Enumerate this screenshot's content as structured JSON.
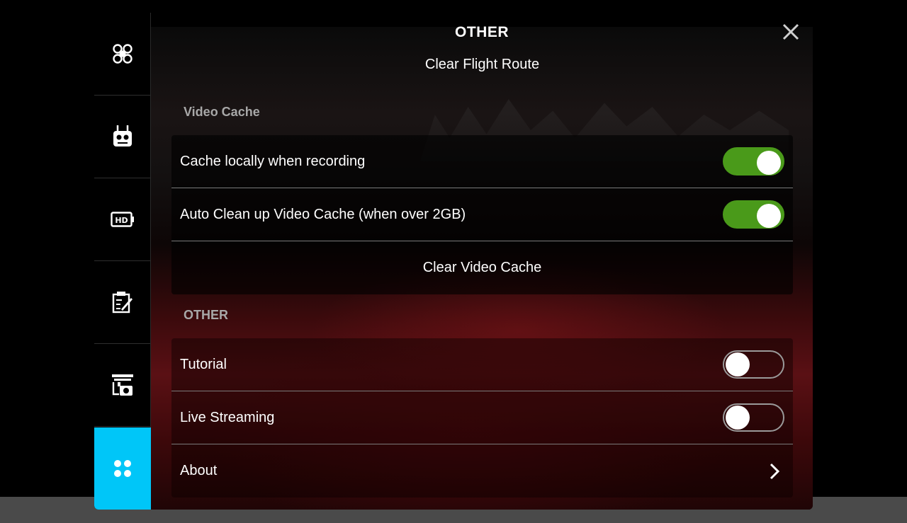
{
  "header": {
    "title": "OTHER"
  },
  "sidebar": {
    "items": [
      {
        "icon": "aircraft-icon"
      },
      {
        "icon": "remote-controller-icon"
      },
      {
        "icon": "hd-transmission-icon"
      },
      {
        "icon": "checklist-icon"
      },
      {
        "icon": "gimbal-camera-icon"
      },
      {
        "icon": "more-dots-icon",
        "active": true
      }
    ],
    "active_color": "#00c6f8"
  },
  "clear_flight_route": "Clear Flight Route",
  "video_cache": {
    "label": "Video Cache",
    "rows": [
      {
        "label": "Cache locally when recording",
        "toggle": true
      },
      {
        "label": "Auto Clean up Video Cache (when over 2GB)",
        "toggle": true
      }
    ],
    "clear_label": "Clear Video Cache"
  },
  "other": {
    "label": "OTHER",
    "rows": [
      {
        "label": "Tutorial",
        "toggle": false
      },
      {
        "label": "Live Streaming",
        "toggle": false
      },
      {
        "label": "About"
      }
    ]
  },
  "colors": {
    "toggle_on": "#4a9a1a",
    "accent": "#00c6f8"
  }
}
